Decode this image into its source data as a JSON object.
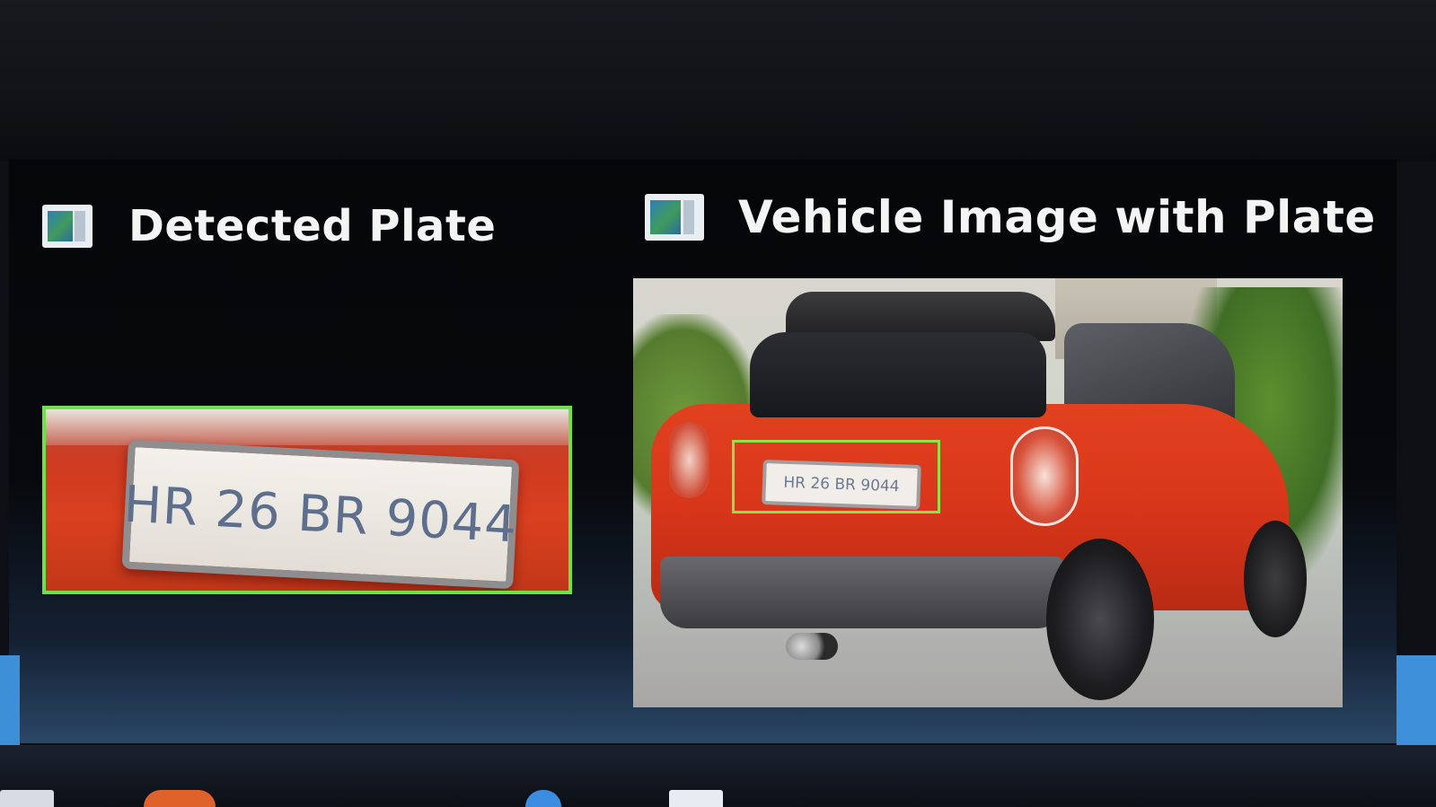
{
  "panels": {
    "left": {
      "title": "Detected Plate",
      "icon": "image-viewer-icon",
      "plate_text": "HR 26 BR 9044",
      "box_color": "#6fe04a"
    },
    "right": {
      "title": "Vehicle Image with Plate",
      "icon": "image-viewer-icon",
      "plate_text": "HR 26 BR 9044",
      "box_color": "#8fe24c",
      "car_color": "#d8361a"
    }
  },
  "accent": "#3d8fd8"
}
